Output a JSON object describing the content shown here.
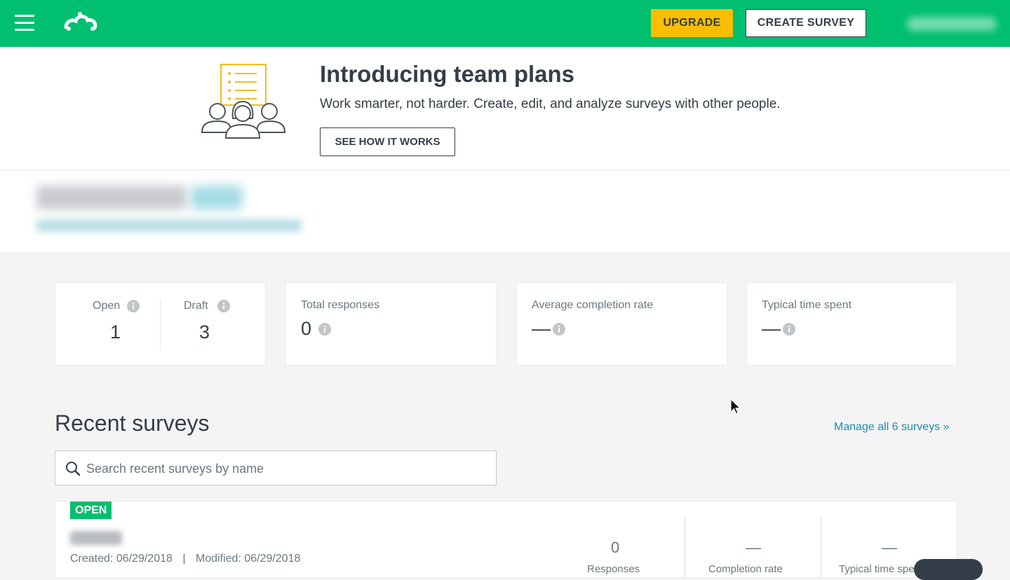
{
  "header": {
    "upgrade_label": "UPGRADE",
    "create_survey_label": "CREATE SURVEY",
    "brand_color": "#00bf6f",
    "upgrade_color": "#f9be00"
  },
  "promo": {
    "title": "Introducing team plans",
    "text": "Work smarter, not harder. Create, edit, and analyze surveys with other people.",
    "button_label": "SEE HOW IT WORKS"
  },
  "stats": {
    "open_label": "Open",
    "open_value": "1",
    "draft_label": "Draft",
    "draft_value": "3",
    "total_responses_label": "Total responses",
    "total_responses_value": "0",
    "avg_completion_label": "Average completion rate",
    "avg_completion_value": "—",
    "typical_time_label": "Typical time spent",
    "typical_time_value": "—"
  },
  "recent": {
    "title": "Recent surveys",
    "manage_link": "Manage all 6 surveys »",
    "search_placeholder": "Search recent surveys by name"
  },
  "survey": {
    "status": "OPEN",
    "created": "Created: 06/29/2018",
    "separator": "|",
    "modified": "Modified: 06/29/2018",
    "responses_value": "0",
    "responses_label": "Responses",
    "completion_value": "—",
    "completion_label": "Completion rate",
    "time_value": "—",
    "time_label": "Typical time spent"
  },
  "icons": [
    "menu-icon",
    "logo-icon",
    "team-plans-illustration",
    "info-icon",
    "search-icon",
    "mouse-cursor-icon"
  ]
}
